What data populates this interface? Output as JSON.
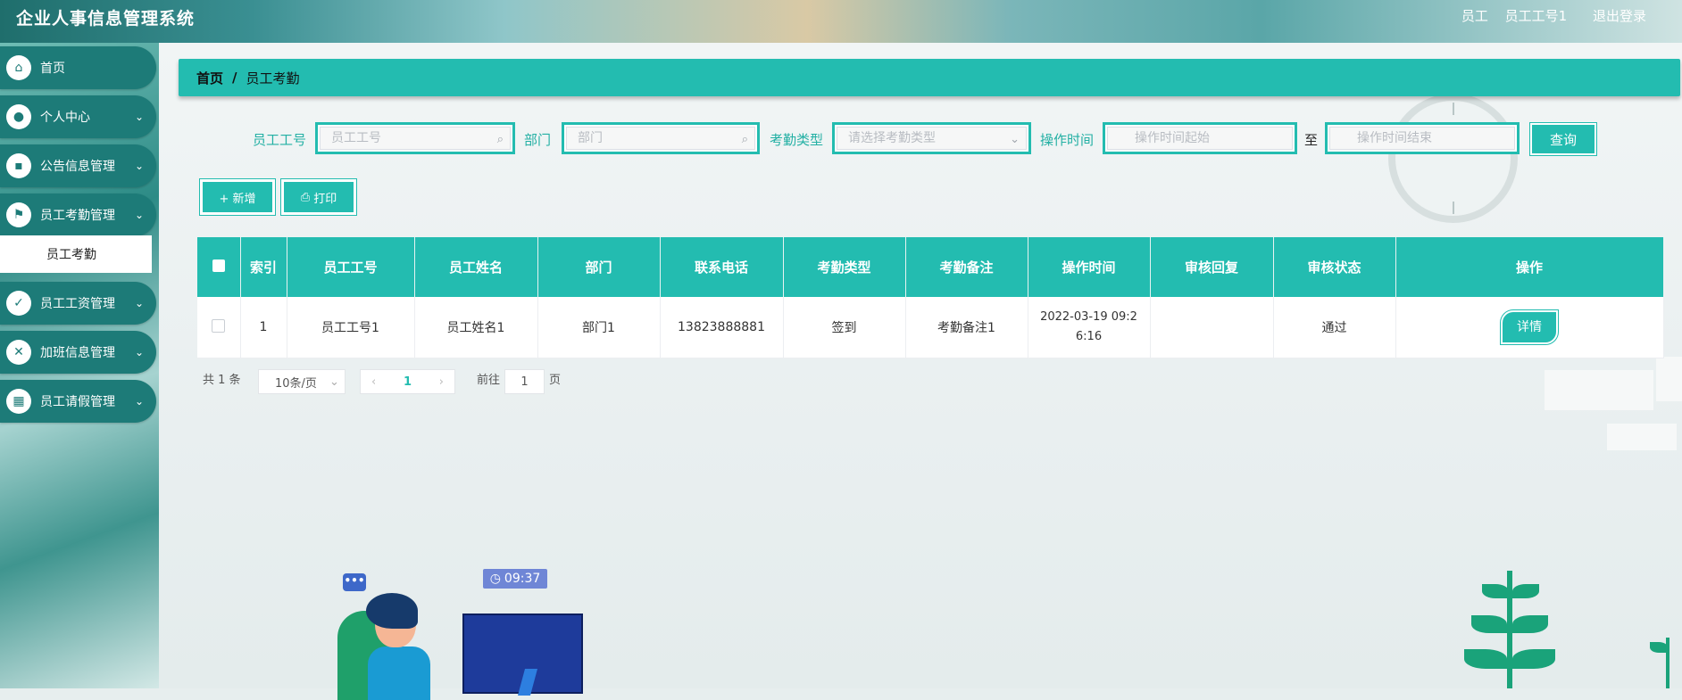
{
  "app": {
    "title": "企业人事信息管理系统"
  },
  "user": {
    "role": "员工",
    "name": "员工工号1",
    "logout": "退出登录"
  },
  "sidebar": {
    "items": [
      {
        "label": "首页"
      },
      {
        "label": "个人中心"
      },
      {
        "label": "公告信息管理"
      },
      {
        "label": "员工考勤管理"
      },
      {
        "label": "员工工资管理"
      },
      {
        "label": "加班信息管理"
      },
      {
        "label": "员工请假管理"
      }
    ],
    "active_sub": "员工考勤"
  },
  "breadcrumb": {
    "home": "首页",
    "sep": "/",
    "current": "员工考勤"
  },
  "search": {
    "emp_no_label": "员工工号",
    "emp_no_placeholder": "员工工号",
    "dept_label": "部门",
    "dept_placeholder": "部门",
    "type_label": "考勤类型",
    "type_placeholder": "请选择考勤类型",
    "time_label": "操作时间",
    "time_start_placeholder": "操作时间起始",
    "to": "至",
    "time_end_placeholder": "操作时间结束",
    "query": "查询"
  },
  "actions": {
    "add": "+ 新增",
    "print": "打印"
  },
  "table": {
    "headers": [
      "",
      "索引",
      "员工工号",
      "员工姓名",
      "部门",
      "联系电话",
      "考勤类型",
      "考勤备注",
      "操作时间",
      "审核回复",
      "审核状态",
      "操作"
    ],
    "rows": [
      {
        "index": "1",
        "emp_no": "员工工号1",
        "emp_name": "员工姓名1",
        "dept": "部门1",
        "phone": "13823888881",
        "type": "签到",
        "note": "考勤备注1",
        "time": "2022-03-19 09:26:16",
        "reply": "",
        "status": "通过",
        "action": "详情"
      }
    ]
  },
  "pagination": {
    "total": "共 1 条",
    "page_size": "10条/页",
    "current": "1",
    "goto_prefix": "前往",
    "goto_value": "1",
    "goto_suffix": "页"
  },
  "illustration": {
    "time": "09:37",
    "bubble": "•••"
  },
  "colors": {
    "primary": "#23bcb0",
    "sidebar": "#1d7b78"
  }
}
